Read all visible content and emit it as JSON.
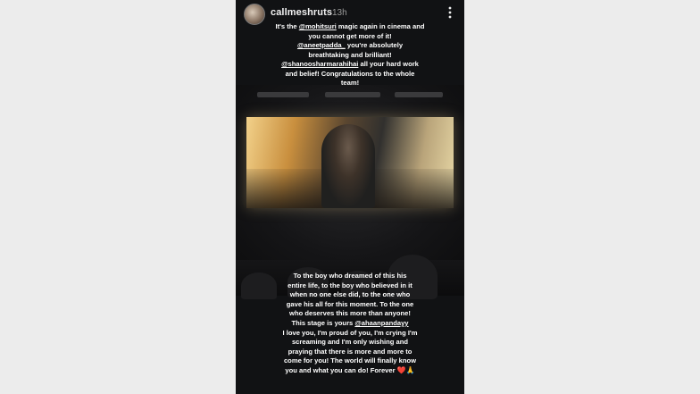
{
  "story": {
    "username": "callmeshruts",
    "timestamp": "13h",
    "top_caption": {
      "l1_a": "It's the ",
      "l1_mention": "@mohitsuri",
      "l1_b": " magic again in cinema and",
      "l2": "you cannot get more of it!",
      "l3_mention": "@aneetpadda_",
      "l3_b": " you're absolutely",
      "l4": "breathtaking and brilliant!",
      "l5_mention": "@shanoosharmarahihai",
      "l5_b": " all your hard work",
      "l6": "and belief! Congratulations to the whole",
      "l7": "team!"
    },
    "bottom_caption": {
      "l1": "To the boy who dreamed of this his",
      "l2": "entire life, to the boy who believed in it",
      "l3": "when no one else did, to the one who",
      "l4": "gave his all for this moment. To the one",
      "l5": "who deserves this more than anyone!",
      "l6_a": "This stage is yours ",
      "l6_mention": "@ahaanpandayy",
      "l7": "I love you, I'm proud of you, I'm crying I'm",
      "l8": "screaming and I'm only wishing and",
      "l9": "praying that there is more and more to",
      "l10": "come for you! The world will finally know",
      "l11": "you and what you can do!  Forever ",
      "heart": "❤️",
      "hands": "🙏"
    }
  },
  "colors": {
    "page_bg": "#ececec",
    "story_bg": "#111214",
    "text": "#ffffff",
    "heart": "#e0243c"
  }
}
